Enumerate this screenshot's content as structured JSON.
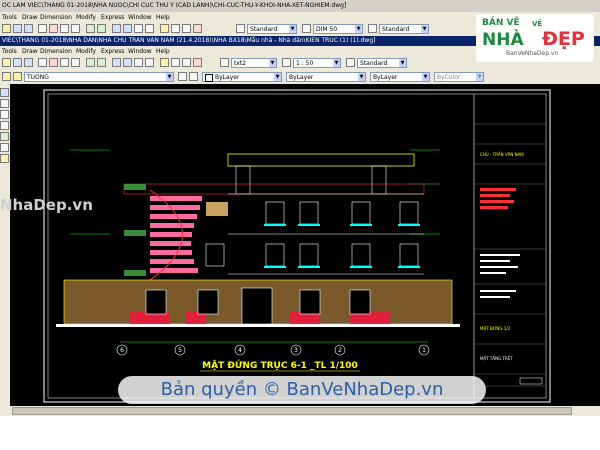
{
  "window1": {
    "title": "OC LAM VIEC\\THANG 01-2018\\NHA NUOC\\CHI CUC THU Y (CAD LANH)\\CHI-CUC-THU-Y-KHOI-NHA-XET-NGHIEM.dwg]",
    "menu": [
      "Tools",
      "Draw",
      "Dimension",
      "Modify",
      "Express",
      "Window",
      "Help"
    ],
    "combos": {
      "text_style": "Standard",
      "dim_style": "DIM 50",
      "table_style": "Standard"
    }
  },
  "window2": {
    "title": "VIEC\\THANG 01-2018\\NHA DAN\\NHA CHU TRAN VAN NAM (21.4.2018)\\NHA BX18\\Mẫu nhà - Nhà dân\\KIEN TRUC (1) (1).dwg]",
    "menu": [
      "Tools",
      "Draw",
      "Dimension",
      "Modify",
      "Express",
      "Window",
      "Help"
    ],
    "combos": {
      "style": "txt2",
      "scale": "1 : 50",
      "table": "Standard"
    }
  },
  "properties": {
    "layer": "TUONG",
    "color": "ByLayer",
    "linetype": "ByLayer",
    "lineweight": "ByLayer",
    "plotstyle": "ByColor"
  },
  "drawing": {
    "title": "MẶT ĐỨNG TRỤC 6-1 _TL 1/100",
    "grid_bubbles": [
      "6",
      "5",
      "4",
      "3",
      "2",
      "1"
    ],
    "title_block": {
      "owner": "CHỦ : TRẦN VĂN NAM",
      "sheet": "MẶT ĐỨNG 1/2",
      "floor": "MẶT TẦNG TRỆT"
    }
  },
  "watermarks": {
    "left": "NhaDep.vn",
    "bottom": "Bản quyền © BanVeNhaDep.vn"
  },
  "logo": {
    "line1": "BẢN VẼ",
    "line2": "NHÀ",
    "line3": "VỀ",
    "line4": "ĐẸP",
    "line5": "BanVeNhaDep.vn"
  },
  "colors": {
    "model_bg": "#000000",
    "toolbar": "#ece9d8",
    "active_title": "#0a246a",
    "accent_red": "#e01f3a",
    "cad_yellow": "#ffff00",
    "cad_cyan": "#00ffff",
    "cad_green": "#00ff00"
  }
}
